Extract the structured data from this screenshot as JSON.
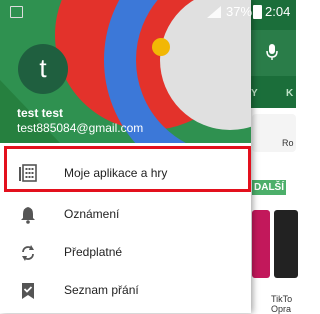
{
  "status_bar": {
    "battery_percent": "37%",
    "time": "2:04"
  },
  "background_app": {
    "tab_partial_left": "Y",
    "tab_partial_right": "K",
    "chip_label": "Ro",
    "section_label": "DALŠÍ",
    "app_label_line1": "TikTo",
    "app_label_line2": "Opra"
  },
  "account": {
    "avatar_letter": "t",
    "name": "test test",
    "email": "test885084@gmail.com"
  },
  "menu": {
    "items": [
      {
        "label": "Moje aplikace a hry",
        "icon": "apps-grid-icon",
        "highlighted": true
      },
      {
        "label": "Oznámení",
        "icon": "bell-icon"
      },
      {
        "label": "Předplatné",
        "icon": "refresh-icon"
      },
      {
        "label": "Seznam přání",
        "icon": "bookmark-check-icon"
      }
    ]
  },
  "colors": {
    "highlight": "#e3101d",
    "header_green": "#2f9150",
    "avatar": "#1f5f3f"
  }
}
